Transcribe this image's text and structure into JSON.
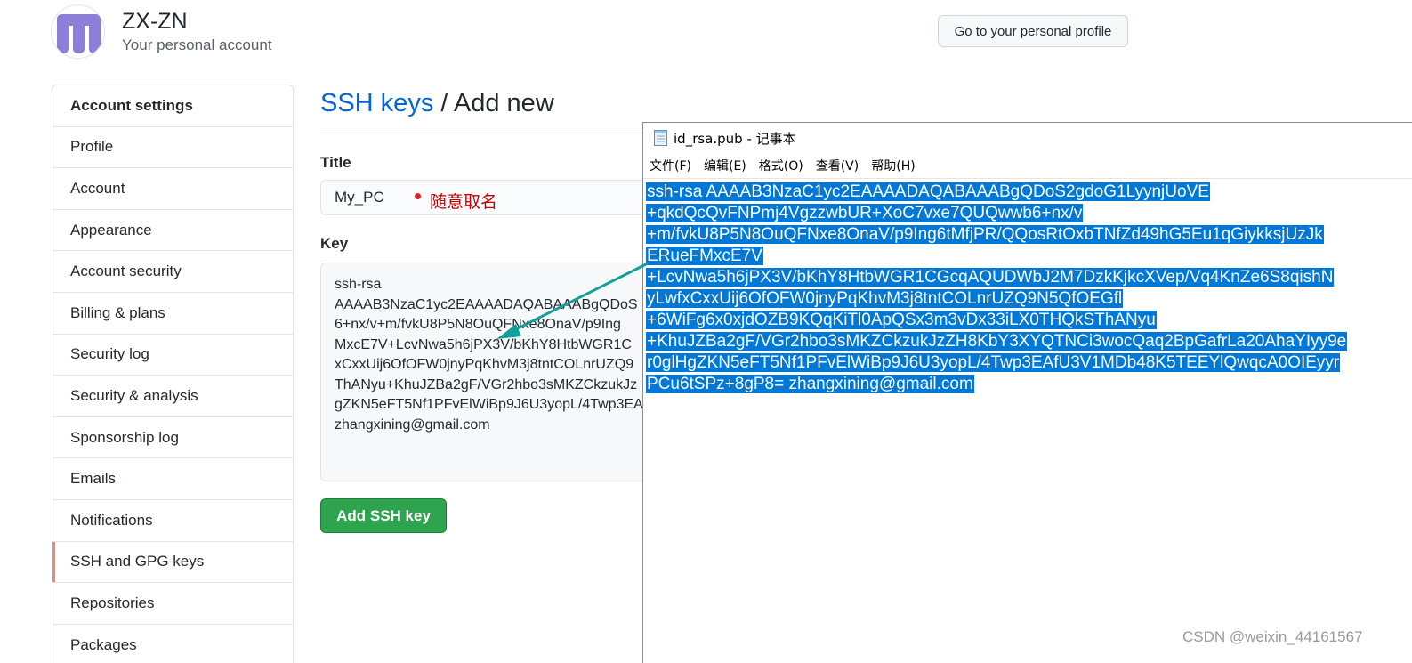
{
  "header": {
    "account_name": "ZX-ZN",
    "account_subtitle": "Your personal account",
    "profile_button": "Go to your personal profile"
  },
  "sidebar": {
    "items": [
      {
        "label": "Account settings"
      },
      {
        "label": "Profile"
      },
      {
        "label": "Account"
      },
      {
        "label": "Appearance"
      },
      {
        "label": "Account security"
      },
      {
        "label": "Billing & plans"
      },
      {
        "label": "Security log"
      },
      {
        "label": "Security & analysis"
      },
      {
        "label": "Sponsorship log"
      },
      {
        "label": "Emails"
      },
      {
        "label": "Notifications"
      },
      {
        "label": "SSH and GPG keys"
      },
      {
        "label": "Repositories"
      },
      {
        "label": "Packages"
      }
    ]
  },
  "main": {
    "title_link": "SSH keys",
    "title_rest": " / Add new",
    "title_label": "Title",
    "title_value": "My_PC",
    "title_annotation": "随意取名",
    "key_label": "Key",
    "key_lines": [
      "ssh-rsa",
      "AAAAB3NzaC1yc2EAAAADAQABAAABgQDoS",
      "6+nx/v+m/fvkU8P5N8OuQFNxe8OnaV/p9Ing",
      "MxcE7V+LcvNwa5h6jPX3V/bKhY8HtbWGR1C",
      "xCxxUij6OfOFW0jnyPqKhvM3j8tntCOLnrUZQ9",
      "ThANyu+KhuJZBa2gF/VGr2hbo3sMKZCkzukJz",
      "gZKN5eFT5Nf1PFvElWiBp9J6U3yopL/4Twp3EA",
      "zhangxining@gmail.com"
    ],
    "add_button": "Add SSH key"
  },
  "notepad": {
    "title": "id_rsa.pub - 记事本",
    "menu": [
      "文件(F)",
      "编辑(E)",
      "格式(O)",
      "查看(V)",
      "帮助(H)"
    ],
    "lines": [
      "ssh-rsa AAAAB3NzaC1yc2EAAAADAQABAAABgQDoS2gdoG1LyynjUoVE",
      "+qkdQcQvFNPmj4VgzzwbUR+XoC7vxe7QUQwwb6+nx/v",
      "+m/fvkU8P5N8OuQFNxe8OnaV/p9Ing6tMfjPR/QQosRtOxbTNfZd49hG5Eu1qGiykksjUzJk",
      "ERueFMxcE7V",
      "+LcvNwa5h6jPX3V/bKhY8HtbWGR1CGcqAQUDWbJ2M7DzkKjkcXVep/Vq4KnZe6S8qishN",
      "yLwfxCxxUij6OfOFW0jnyPqKhvM3j8tntCOLnrUZQ9N5QfOEGfl",
      "+6WiFg6x0xjdOZB9KQqKiTl0ApQSx3m3vDx33iLX0THQkSThANyu",
      "+KhuJZBa2gF/VGr2hbo3sMKZCkzukJzZH8KbY3XYQTNCi3wocQaq2BpGafrLa20AhaYIyy9e",
      "r0glHgZKN5eFT5Nf1PFvElWiBp9J6U3yopL/4Twp3EAfU3V1MDb48K5TEEYlQwqcA0OIEyyr",
      "PCu6tSPz+8gP8= zhangxining@gmail.com"
    ]
  },
  "watermark": "CSDN @weixin_44161567",
  "colors": {
    "link": "#0366d6",
    "primary_button": "#2ea44f",
    "selected_indicator": "#f9826c",
    "selection_highlight": "#0078d7",
    "annotation_arrow": "#159f9a",
    "annotation_text": "#c00000"
  }
}
